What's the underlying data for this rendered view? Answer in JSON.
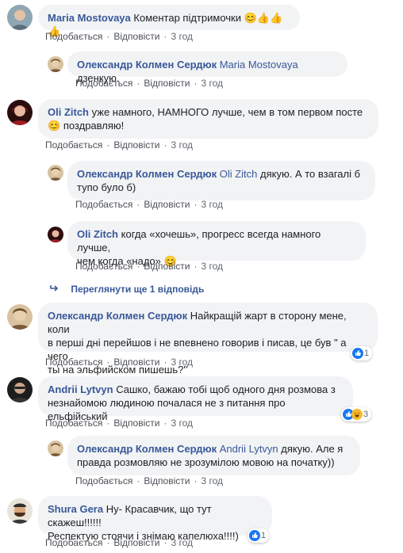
{
  "actions": {
    "like": "Подобається",
    "reply": "Відповісти"
  },
  "comments": [
    {
      "author": "Maria Mostovaya",
      "text": "Коментар підтримочки",
      "emoji": "😊👍👍👍",
      "time": "3 год"
    },
    {
      "author": "Олександр Колмен Сердюк",
      "mention": "Maria Mostovaya",
      "text": "дзенкую.",
      "time": "3 год"
    },
    {
      "author": "Oli Zitch",
      "line1": "уже намного, НАМНОГО лучше, чем в том первом посте",
      "line2_emoji": "😊",
      "line2": "поздравляю!",
      "time": "3 год"
    },
    {
      "author": "Олександр Колмен Сердюк",
      "mention": "Oli Zitch",
      "line1": "дякую. А то взагалі б",
      "line2": "тупо було б)",
      "time": "3 год"
    },
    {
      "author": "Oli Zitch",
      "line1": "когда «хочешь», прогресс всегда намного лучше,",
      "line2": "чем когда «надо»",
      "line2_emoji": "😊",
      "time": "3 год"
    },
    {
      "author": "Олександр Колмен Сердюк",
      "line1": "Найкращій жарт в сторону мене, коли",
      "line2": "в перші дні перейшов і не впевнено говорив і писав, це був \" а чего",
      "line3": "ты на эльфийском пишешь?\"",
      "time": "3 год",
      "reactions": "1"
    },
    {
      "author": "Andrii Lytvyn",
      "line1": "Сашко, бажаю тобі щоб одного дня розмова з",
      "line2": "незнайомою людиною почалася не з питання про ельфійський",
      "time": "3 год",
      "reactions": "3"
    },
    {
      "author": "Олександр Колмен Сердюк",
      "mention": "Andrii Lytvyn",
      "line1": "дякую. Але я",
      "line2": "правда розмовляю не зрозумілою мовою на початку))",
      "time": "3 год"
    },
    {
      "author": "Shura Gera",
      "line1": "Ну- Красавчик, що тут скажеш!!!!!!",
      "line2": "Респектую стоячи і знімаю капелюха!!!!)",
      "time": "3 год",
      "reactions": "1"
    }
  ],
  "view_more": "Переглянути ще 1 відповідь"
}
